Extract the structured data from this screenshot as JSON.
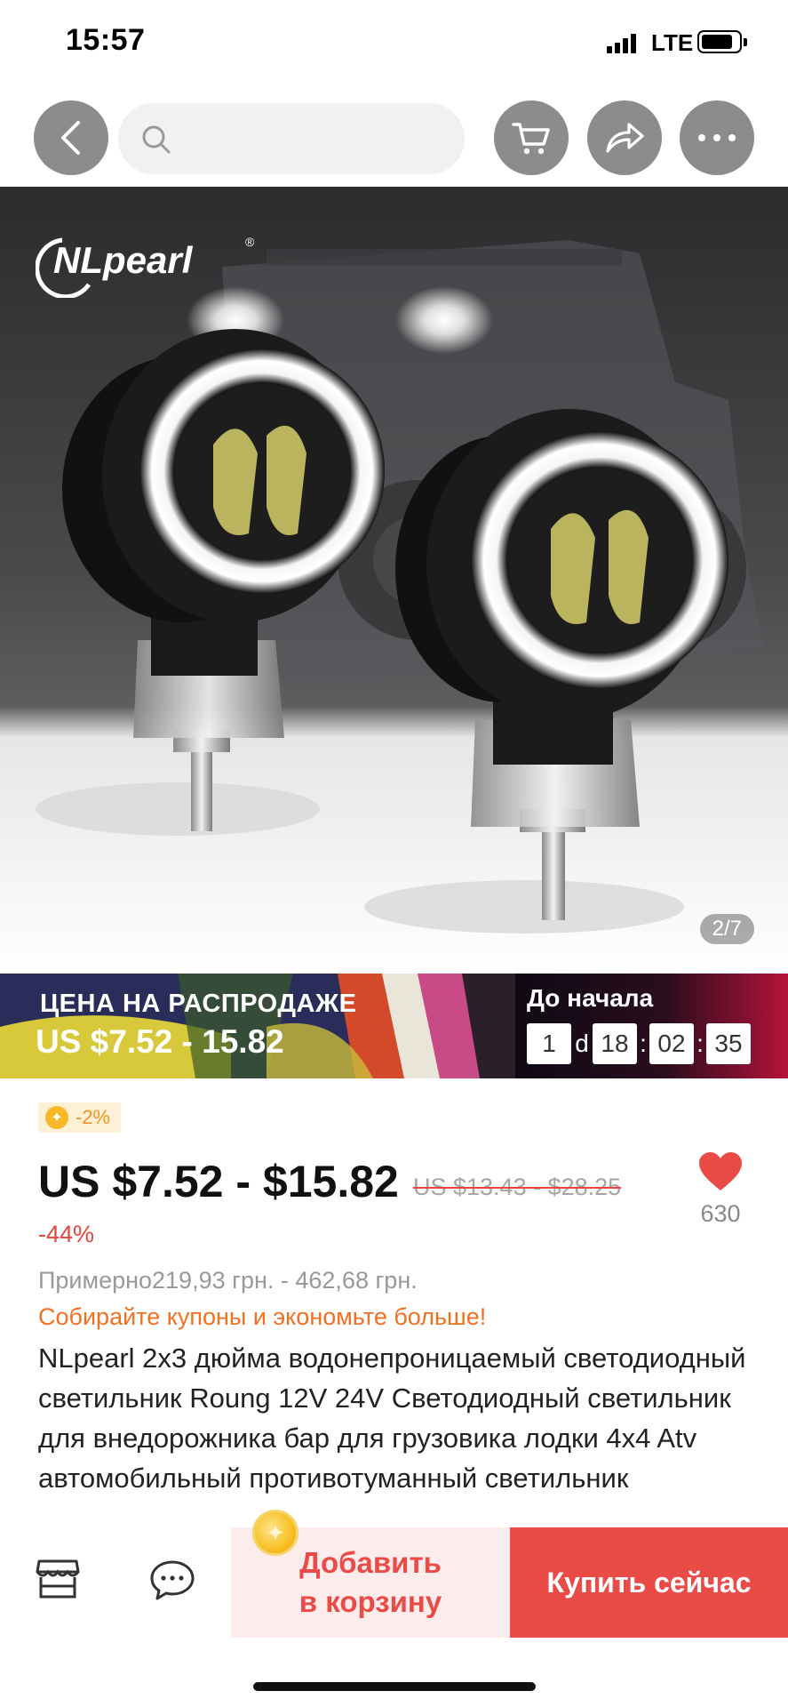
{
  "status_bar": {
    "time": "15:57",
    "network": "LTE"
  },
  "nav": {
    "search_placeholder": ""
  },
  "product_image": {
    "brand": "NLpearl",
    "counter": "2/7"
  },
  "sale_banner": {
    "title": "ЦЕНА НА РАСПРОДАЖЕ",
    "price": "US $7.52 - 15.82",
    "timer_label": "До начала",
    "timer": {
      "days": "1",
      "day_unit": "d",
      "hours": "18",
      "minutes": "02",
      "seconds": "35"
    },
    "colors": {
      "timer_accent": "#b5123a"
    }
  },
  "price": {
    "coupon_badge": "-2%",
    "current": "US $7.52 - $15.82",
    "original": "US $13.43 - $28.25",
    "discount": "-44%",
    "wishlist_count": "630",
    "approx": "Примерно219,93 грн. - 462,68 грн.",
    "coupons_cta": "Собирайте купоны и экономьте больше!"
  },
  "product": {
    "title": "NLpearl 2x3 дюйма водонепроницаемый светодиодный светильник Roung 12V 24V Светодиодный светильник для внедорожника бар для грузовика лодки 4x4 Atv автомобильный противотуманный светильник"
  },
  "bottom_bar": {
    "add_to_cart": "Добавить\nв корзину",
    "buy_now": "Купить сейчас"
  },
  "colors": {
    "accent": "#ea4b47",
    "coupon_text": "#f37021",
    "heart": "#ea4b47"
  },
  "icons": [
    "back-arrow-icon",
    "search-icon",
    "cart-icon",
    "share-icon",
    "more-icon",
    "heart-icon",
    "store-icon",
    "chat-icon",
    "coin-icon"
  ]
}
